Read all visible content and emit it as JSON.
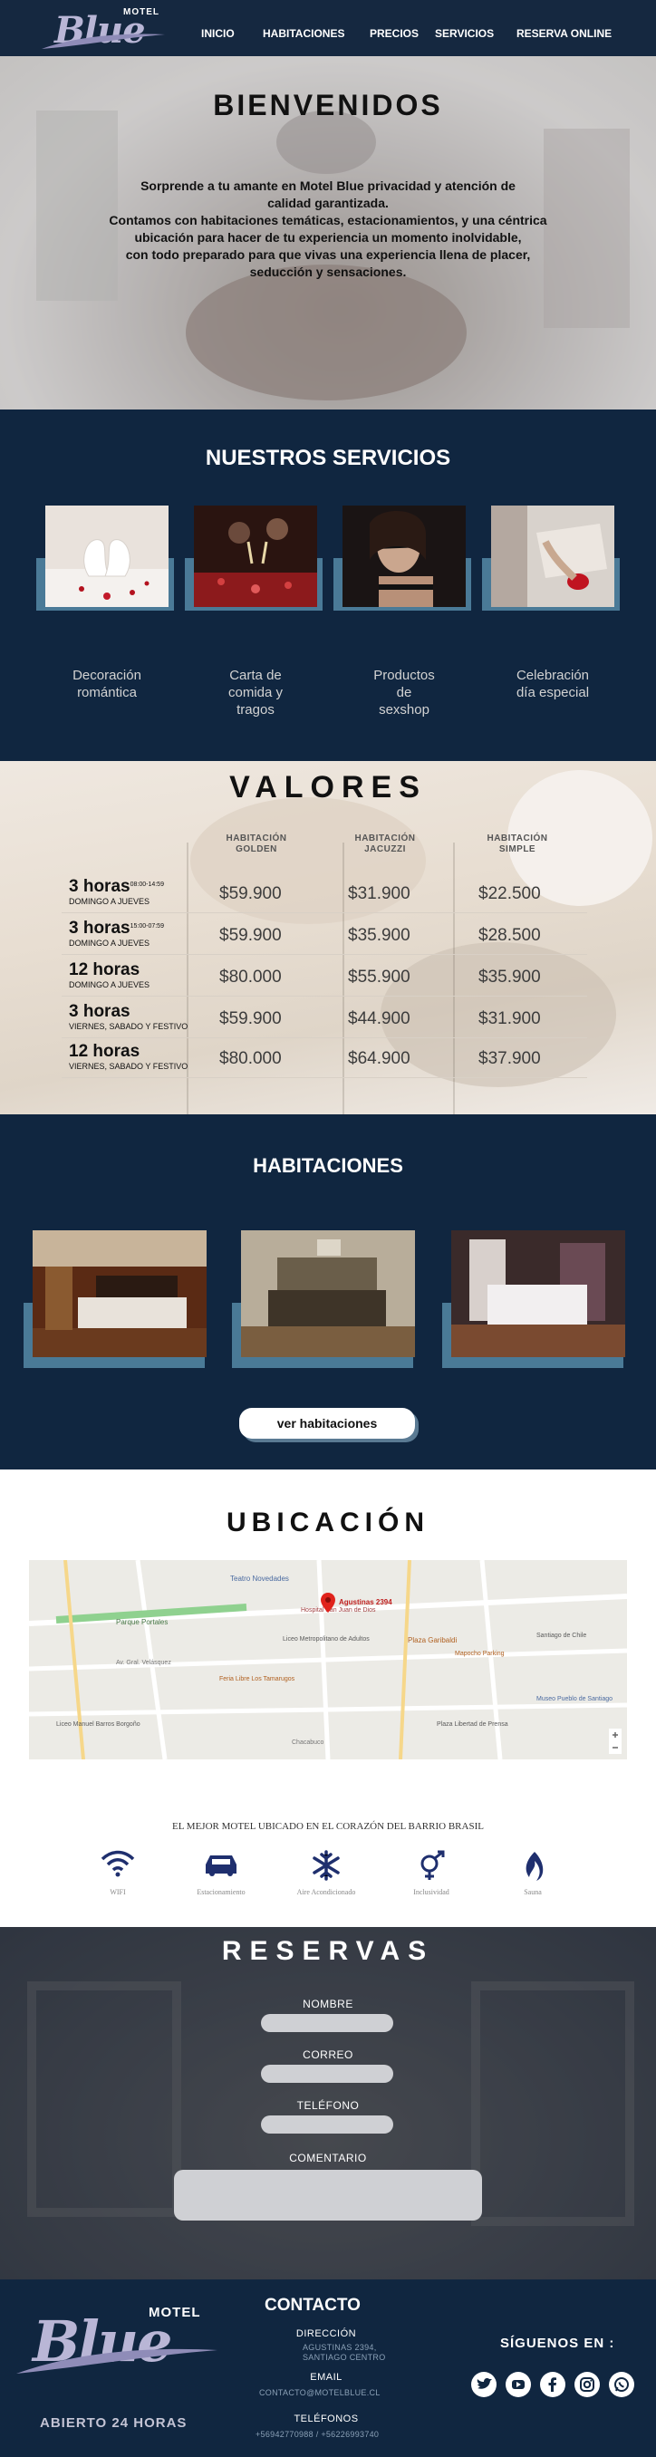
{
  "header": {
    "logo_small": "MOTEL",
    "logo_big": "Blue",
    "nav": [
      "INICIO",
      "HABITACIONES",
      "PRECIOS",
      "SERVICIOS",
      "RESERVA ONLINE"
    ]
  },
  "hero": {
    "title": "BIENVENIDOS",
    "lines": [
      "Sorprende a tu amante en Motel Blue privacidad y atención de",
      "calidad garantizada.",
      "Contamos con habitaciones temáticas, estacionamientos, y una céntrica",
      "ubicación para hacer de tu experiencia un momento inolvidable,",
      "con todo preparado para que vivas una experiencia llena de placer,",
      "seducción y sensaciones."
    ]
  },
  "services": {
    "title": "NUESTROS SERVICIOS",
    "items": [
      {
        "label_lines": [
          "Decoración",
          "romántica"
        ],
        "image": "swans-towel-photo"
      },
      {
        "label_lines": [
          "Carta de",
          "comida y",
          "tragos"
        ],
        "image": "champagne-toast-photo"
      },
      {
        "label_lines": [
          "Productos",
          "de",
          "sexshop"
        ],
        "image": "blindfold-photo"
      },
      {
        "label_lines": [
          "Celebración",
          "día especial"
        ],
        "image": "gift-ring-photo"
      }
    ]
  },
  "valores": {
    "title": "VALORES",
    "columns": [
      [
        "HABITACIÓN",
        "GOLDEN"
      ],
      [
        "HABITACIÓN",
        "JACUZZI"
      ],
      [
        "HABITACIÓN",
        "SIMPLE"
      ]
    ],
    "rows": [
      {
        "hours": "3 horas",
        "time": "08:00-14:59",
        "days": "DOMINGO A JUEVES",
        "prices": [
          "$59.900",
          "$31.900",
          "$22.500"
        ]
      },
      {
        "hours": "3 horas",
        "time": "15:00-07:59",
        "days": "DOMINGO A JUEVES",
        "prices": [
          "$59.900",
          "$35.900",
          "$28.500"
        ]
      },
      {
        "hours": "12 horas",
        "time": "",
        "days": "DOMINGO A JUEVES",
        "prices": [
          "$80.000",
          "$55.900",
          "$35.900"
        ]
      },
      {
        "hours": "3 horas",
        "time": "",
        "days": "VIERNES, SABADO Y FESTIVO",
        "prices": [
          "$59.900",
          "$44.900",
          "$31.900"
        ]
      },
      {
        "hours": "12 horas",
        "time": "",
        "days": "VIERNES, SABADO Y FESTIVO",
        "prices": [
          "$80.000",
          "$64.900",
          "$37.900"
        ]
      }
    ]
  },
  "habitaciones": {
    "title": "HABITACIONES",
    "rooms": [
      "room-photo-1",
      "room-photo-2",
      "room-photo-3"
    ],
    "button": "ver habitaciones"
  },
  "ubicacion": {
    "title": "UBICACIÓN",
    "map": {
      "pin_label": "Agustinas 2394",
      "places": [
        "Teatro Novedades",
        "Parque Portales",
        "Hospital San Juan de Dios",
        "Liceo Metropolitano de Adultos",
        "Plaza Garibaldi",
        "Mapocho Parking",
        "Feria Libre Los Tamarugos",
        "Plaza Libertad de Prensa",
        "Museo Pueblo de Santiago",
        "Liceo Manuel Barros Borgoño",
        "Santiago de Chile"
      ],
      "streets": [
        "Av. Gral. Velásquez",
        "Chacabuco"
      ]
    },
    "features_title": "EL MEJOR MOTEL UBICADO EN EL CORAZÓN DEL BARRIO BRASIL",
    "features": [
      {
        "icon": "wifi-icon",
        "label": "WIFI"
      },
      {
        "icon": "car-icon",
        "label": "Estacionamiento"
      },
      {
        "icon": "snowflake-icon",
        "label": "Aire Acondicionado"
      },
      {
        "icon": "gender-icon",
        "label": "Inclusividad"
      },
      {
        "icon": "flame-icon",
        "label": "Sauna"
      }
    ],
    "accent": "#1f2f6e"
  },
  "reservas": {
    "title": "RESERVAS",
    "labels": {
      "name": "NOMBRE",
      "email": "CORREO",
      "phone": "TELÉFONO",
      "comment": "COMENTARIO"
    }
  },
  "footer": {
    "logo_small": "MOTEL",
    "logo_big": "Blue",
    "open": "ABIERTO 24 HORAS",
    "contact_title": "CONTACTO",
    "address_label": "DIRECCIÓN",
    "address_lines": [
      "AGUSTINAS 2394,",
      "SANTIAGO CENTRO"
    ],
    "email_label": "EMAIL",
    "email": "CONTACTO@MOTELBLUE.CL",
    "phone_label": "TELÉFONOS",
    "phones": "+56942770988 / +56226993740",
    "follow": "SÍGUENOS EN :",
    "social": [
      "twitter-icon",
      "youtube-icon",
      "facebook-icon",
      "instagram-icon",
      "whatsapp-icon"
    ]
  },
  "colors": {
    "navy": "#102640",
    "steel": "#4a7a97",
    "logo": "#b9b6d6"
  }
}
